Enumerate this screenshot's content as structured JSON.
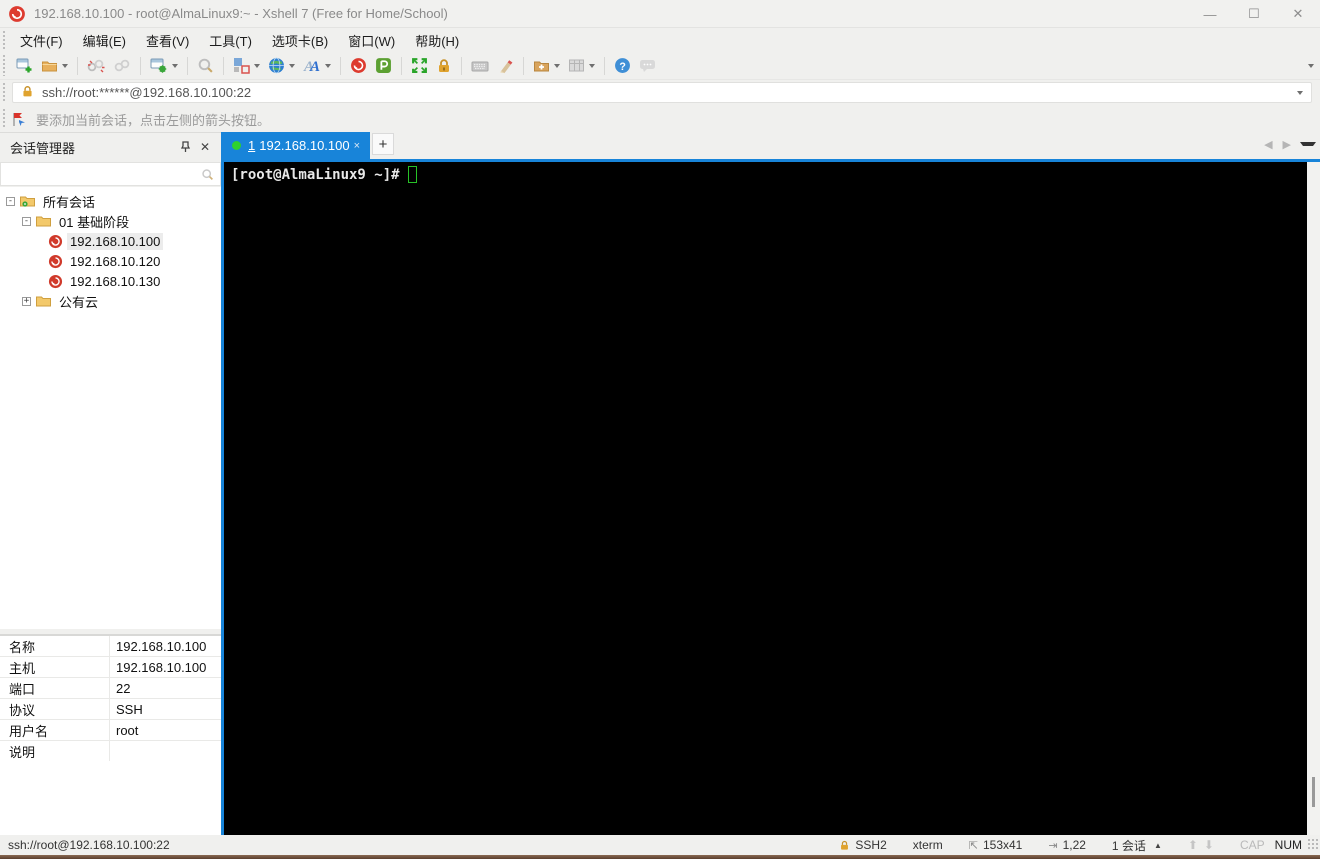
{
  "window": {
    "title": "192.168.10.100 - root@AlmaLinux9:~ - Xshell 7 (Free for Home/School)"
  },
  "menu": {
    "items": [
      "文件(F)",
      "编辑(E)",
      "查看(V)",
      "工具(T)",
      "选项卡(B)",
      "窗口(W)",
      "帮助(H)"
    ]
  },
  "toolbar": {
    "icons": [
      "new-session",
      "open-session",
      "disconnect",
      "reconnect",
      "session-properties",
      "find",
      "layout",
      "encoding-globe",
      "font",
      "xshell",
      "xftp",
      "fullscreen",
      "lock-screen",
      "virtual-keyboard",
      "highlight-pen",
      "new-tab-folder",
      "tab-arrange",
      "help",
      "feedback"
    ]
  },
  "address_bar": {
    "value": "ssh://root:******@192.168.10.100:22"
  },
  "info_bar": {
    "text": "要添加当前会话，点击左侧的箭头按钮。"
  },
  "sidebar": {
    "title": "会话管理器",
    "search_placeholder": "",
    "tree": [
      {
        "label": "所有会话",
        "icon": "folder-gear",
        "expander": "-"
      },
      {
        "label": "01 基础阶段",
        "icon": "folder",
        "expander": "-"
      },
      {
        "label": "192.168.10.100",
        "icon": "session",
        "selected": true
      },
      {
        "label": "192.168.10.120",
        "icon": "session"
      },
      {
        "label": "192.168.10.130",
        "icon": "session"
      },
      {
        "label": "公有云",
        "icon": "folder",
        "expander": "+"
      }
    ],
    "properties": [
      {
        "label": "名称",
        "value": "192.168.10.100"
      },
      {
        "label": "主机",
        "value": "192.168.10.100"
      },
      {
        "label": "端口",
        "value": "22"
      },
      {
        "label": "协议",
        "value": "SSH"
      },
      {
        "label": "用户名",
        "value": "root"
      },
      {
        "label": "说明",
        "value": ""
      }
    ]
  },
  "tabs": {
    "active_num": "1",
    "active_label": "192.168.10.100",
    "close": "×",
    "new_tab": "+"
  },
  "terminal": {
    "prompt": "[root@AlmaLinux9 ~]#"
  },
  "status": {
    "left": "ssh://root@192.168.10.100:22",
    "protocol": "SSH2",
    "term_type": "xterm",
    "size": "153x41",
    "cursor_pos": "1,22",
    "sessions": "1 会话",
    "cap": "CAP",
    "num": "NUM"
  },
  "colors": {
    "accent_blue": "#1884d9",
    "terminal_bg": "#000000",
    "terminal_fg": "#e8e8e8",
    "cursor_green": "#27c227",
    "logo_red": "#dd3b2f",
    "folder_yellow": "#f3c96b",
    "chrome": "#f0f0ee",
    "bottom_strip": "#6d4c39"
  }
}
